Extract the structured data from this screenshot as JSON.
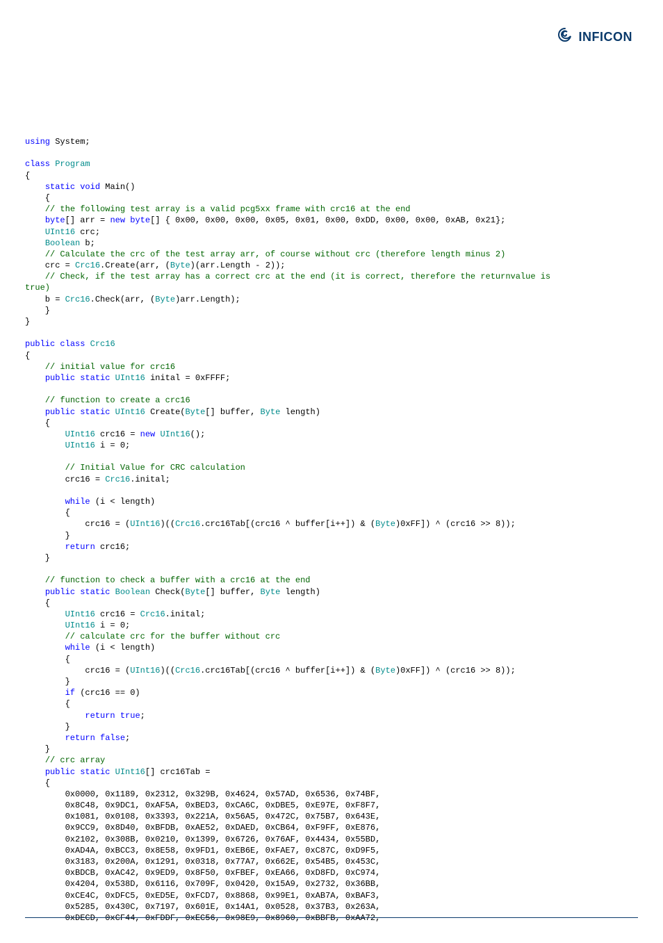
{
  "logo_text": "INFICON",
  "code_lines": [
    {
      "segments": [
        {
          "c": "kw",
          "t": "using"
        },
        {
          "c": "",
          "t": " System;"
        }
      ]
    },
    {
      "segments": [
        {
          "c": "",
          "t": ""
        }
      ]
    },
    {
      "segments": [
        {
          "c": "kw",
          "t": "class"
        },
        {
          "c": "",
          "t": " "
        },
        {
          "c": "typ",
          "t": "Program"
        }
      ]
    },
    {
      "segments": [
        {
          "c": "",
          "t": "{"
        }
      ]
    },
    {
      "segments": [
        {
          "c": "",
          "t": "    "
        },
        {
          "c": "kw",
          "t": "static"
        },
        {
          "c": "",
          "t": " "
        },
        {
          "c": "kw",
          "t": "void"
        },
        {
          "c": "",
          "t": " Main()"
        }
      ]
    },
    {
      "segments": [
        {
          "c": "",
          "t": "    {"
        }
      ]
    },
    {
      "segments": [
        {
          "c": "",
          "t": "    "
        },
        {
          "c": "cmt",
          "t": "// the following test array is a valid pcg5xx frame with crc16 at the end"
        }
      ]
    },
    {
      "segments": [
        {
          "c": "",
          "t": "    "
        },
        {
          "c": "kw",
          "t": "byte"
        },
        {
          "c": "",
          "t": "[] arr = "
        },
        {
          "c": "kw",
          "t": "new"
        },
        {
          "c": "",
          "t": " "
        },
        {
          "c": "kw",
          "t": "byte"
        },
        {
          "c": "",
          "t": "[] { 0x00, 0x00, 0x00, 0x05, 0x01, 0x00, 0xDD, 0x00, 0x00, 0xAB, 0x21};"
        }
      ]
    },
    {
      "segments": [
        {
          "c": "",
          "t": "    "
        },
        {
          "c": "typ",
          "t": "UInt16"
        },
        {
          "c": "",
          "t": " crc;"
        }
      ]
    },
    {
      "segments": [
        {
          "c": "",
          "t": "    "
        },
        {
          "c": "typ",
          "t": "Boolean"
        },
        {
          "c": "",
          "t": " b;"
        }
      ]
    },
    {
      "segments": [
        {
          "c": "",
          "t": "    "
        },
        {
          "c": "cmt",
          "t": "// Calculate the crc of the test array arr, of course without crc (therefore length minus 2)"
        }
      ]
    },
    {
      "segments": [
        {
          "c": "",
          "t": "    crc = "
        },
        {
          "c": "typ",
          "t": "Crc16"
        },
        {
          "c": "",
          "t": ".Create(arr, ("
        },
        {
          "c": "typ",
          "t": "Byte"
        },
        {
          "c": "",
          "t": ")(arr.Length - 2));"
        }
      ]
    },
    {
      "segments": [
        {
          "c": "",
          "t": "    "
        },
        {
          "c": "cmt",
          "t": "// Check, if the test array has a correct crc at the end (it is correct, therefore the returnvalue is "
        }
      ]
    },
    {
      "segments": [
        {
          "c": "cmt",
          "t": "true)"
        }
      ]
    },
    {
      "segments": [
        {
          "c": "",
          "t": "    b = "
        },
        {
          "c": "typ",
          "t": "Crc16"
        },
        {
          "c": "",
          "t": ".Check(arr, ("
        },
        {
          "c": "typ",
          "t": "Byte"
        },
        {
          "c": "",
          "t": ")arr.Length);"
        }
      ]
    },
    {
      "segments": [
        {
          "c": "",
          "t": "    }"
        }
      ]
    },
    {
      "segments": [
        {
          "c": "",
          "t": "}"
        }
      ]
    },
    {
      "segments": [
        {
          "c": "",
          "t": ""
        }
      ]
    },
    {
      "segments": [
        {
          "c": "kw",
          "t": "public"
        },
        {
          "c": "",
          "t": " "
        },
        {
          "c": "kw",
          "t": "class"
        },
        {
          "c": "",
          "t": " "
        },
        {
          "c": "typ",
          "t": "Crc16"
        }
      ]
    },
    {
      "segments": [
        {
          "c": "",
          "t": "{"
        }
      ]
    },
    {
      "segments": [
        {
          "c": "",
          "t": "    "
        },
        {
          "c": "cmt",
          "t": "// initial value for crc16"
        }
      ]
    },
    {
      "segments": [
        {
          "c": "",
          "t": "    "
        },
        {
          "c": "kw",
          "t": "public"
        },
        {
          "c": "",
          "t": " "
        },
        {
          "c": "kw",
          "t": "static"
        },
        {
          "c": "",
          "t": " "
        },
        {
          "c": "typ",
          "t": "UInt16"
        },
        {
          "c": "",
          "t": " inital = 0xFFFF;"
        }
      ]
    },
    {
      "segments": [
        {
          "c": "",
          "t": ""
        }
      ]
    },
    {
      "segments": [
        {
          "c": "",
          "t": "    "
        },
        {
          "c": "cmt",
          "t": "// function to create a crc16"
        }
      ]
    },
    {
      "segments": [
        {
          "c": "",
          "t": "    "
        },
        {
          "c": "kw",
          "t": "public"
        },
        {
          "c": "",
          "t": " "
        },
        {
          "c": "kw",
          "t": "static"
        },
        {
          "c": "",
          "t": " "
        },
        {
          "c": "typ",
          "t": "UInt16"
        },
        {
          "c": "",
          "t": " Create("
        },
        {
          "c": "typ",
          "t": "Byte"
        },
        {
          "c": "",
          "t": "[] buffer, "
        },
        {
          "c": "typ",
          "t": "Byte"
        },
        {
          "c": "",
          "t": " length)"
        }
      ]
    },
    {
      "segments": [
        {
          "c": "",
          "t": "    {"
        }
      ]
    },
    {
      "segments": [
        {
          "c": "",
          "t": "        "
        },
        {
          "c": "typ",
          "t": "UInt16"
        },
        {
          "c": "",
          "t": " crc16 = "
        },
        {
          "c": "kw",
          "t": "new"
        },
        {
          "c": "",
          "t": " "
        },
        {
          "c": "typ",
          "t": "UInt16"
        },
        {
          "c": "",
          "t": "();"
        }
      ]
    },
    {
      "segments": [
        {
          "c": "",
          "t": "        "
        },
        {
          "c": "typ",
          "t": "UInt16"
        },
        {
          "c": "",
          "t": " i = 0;"
        }
      ]
    },
    {
      "segments": [
        {
          "c": "",
          "t": ""
        }
      ]
    },
    {
      "segments": [
        {
          "c": "",
          "t": "        "
        },
        {
          "c": "cmt",
          "t": "// Initial Value for CRC calculation"
        }
      ]
    },
    {
      "segments": [
        {
          "c": "",
          "t": "        crc16 = "
        },
        {
          "c": "typ",
          "t": "Crc16"
        },
        {
          "c": "",
          "t": ".inital;"
        }
      ]
    },
    {
      "segments": [
        {
          "c": "",
          "t": ""
        }
      ]
    },
    {
      "segments": [
        {
          "c": "",
          "t": "        "
        },
        {
          "c": "kw",
          "t": "while"
        },
        {
          "c": "",
          "t": " (i < length)"
        }
      ]
    },
    {
      "segments": [
        {
          "c": "",
          "t": "        {"
        }
      ]
    },
    {
      "segments": [
        {
          "c": "",
          "t": "            crc16 = ("
        },
        {
          "c": "typ",
          "t": "UInt16"
        },
        {
          "c": "",
          "t": ")(("
        },
        {
          "c": "typ",
          "t": "Crc16"
        },
        {
          "c": "",
          "t": ".crc16Tab[(crc16 ^ buffer[i++]) & ("
        },
        {
          "c": "typ",
          "t": "Byte"
        },
        {
          "c": "",
          "t": ")0xFF]) ^ (crc16 >> 8));"
        }
      ]
    },
    {
      "segments": [
        {
          "c": "",
          "t": "        }"
        }
      ]
    },
    {
      "segments": [
        {
          "c": "",
          "t": "        "
        },
        {
          "c": "kw",
          "t": "return"
        },
        {
          "c": "",
          "t": " crc16;"
        }
      ]
    },
    {
      "segments": [
        {
          "c": "",
          "t": "    }"
        }
      ]
    },
    {
      "segments": [
        {
          "c": "",
          "t": ""
        }
      ]
    },
    {
      "segments": [
        {
          "c": "",
          "t": "    "
        },
        {
          "c": "cmt",
          "t": "// function to check a buffer with a crc16 at the end"
        }
      ]
    },
    {
      "segments": [
        {
          "c": "",
          "t": "    "
        },
        {
          "c": "kw",
          "t": "public"
        },
        {
          "c": "",
          "t": " "
        },
        {
          "c": "kw",
          "t": "static"
        },
        {
          "c": "",
          "t": " "
        },
        {
          "c": "typ",
          "t": "Boolean"
        },
        {
          "c": "",
          "t": " Check("
        },
        {
          "c": "typ",
          "t": "Byte"
        },
        {
          "c": "",
          "t": "[] buffer, "
        },
        {
          "c": "typ",
          "t": "Byte"
        },
        {
          "c": "",
          "t": " length)"
        }
      ]
    },
    {
      "segments": [
        {
          "c": "",
          "t": "    {"
        }
      ]
    },
    {
      "segments": [
        {
          "c": "",
          "t": "        "
        },
        {
          "c": "typ",
          "t": "UInt16"
        },
        {
          "c": "",
          "t": " crc16 = "
        },
        {
          "c": "typ",
          "t": "Crc16"
        },
        {
          "c": "",
          "t": ".inital;"
        }
      ]
    },
    {
      "segments": [
        {
          "c": "",
          "t": "        "
        },
        {
          "c": "typ",
          "t": "UInt16"
        },
        {
          "c": "",
          "t": " i = 0;"
        }
      ]
    },
    {
      "segments": [
        {
          "c": "",
          "t": "        "
        },
        {
          "c": "cmt",
          "t": "// calculate crc for the buffer without crc"
        }
      ]
    },
    {
      "segments": [
        {
          "c": "",
          "t": "        "
        },
        {
          "c": "kw",
          "t": "while"
        },
        {
          "c": "",
          "t": " (i < length)"
        }
      ]
    },
    {
      "segments": [
        {
          "c": "",
          "t": "        {"
        }
      ]
    },
    {
      "segments": [
        {
          "c": "",
          "t": "            crc16 = ("
        },
        {
          "c": "typ",
          "t": "UInt16"
        },
        {
          "c": "",
          "t": ")(("
        },
        {
          "c": "typ",
          "t": "Crc16"
        },
        {
          "c": "",
          "t": ".crc16Tab[(crc16 ^ buffer[i++]) & ("
        },
        {
          "c": "typ",
          "t": "Byte"
        },
        {
          "c": "",
          "t": ")0xFF]) ^ (crc16 >> 8));"
        }
      ]
    },
    {
      "segments": [
        {
          "c": "",
          "t": "        }"
        }
      ]
    },
    {
      "segments": [
        {
          "c": "",
          "t": "        "
        },
        {
          "c": "kw",
          "t": "if"
        },
        {
          "c": "",
          "t": " (crc16 == 0)"
        }
      ]
    },
    {
      "segments": [
        {
          "c": "",
          "t": "        {"
        }
      ]
    },
    {
      "segments": [
        {
          "c": "",
          "t": "            "
        },
        {
          "c": "kw",
          "t": "return"
        },
        {
          "c": "",
          "t": " "
        },
        {
          "c": "kw",
          "t": "true"
        },
        {
          "c": "",
          "t": ";"
        }
      ]
    },
    {
      "segments": [
        {
          "c": "",
          "t": "        }"
        }
      ]
    },
    {
      "segments": [
        {
          "c": "",
          "t": "        "
        },
        {
          "c": "kw",
          "t": "return"
        },
        {
          "c": "",
          "t": " "
        },
        {
          "c": "kw",
          "t": "false"
        },
        {
          "c": "",
          "t": ";"
        }
      ]
    },
    {
      "segments": [
        {
          "c": "",
          "t": "    }"
        }
      ]
    },
    {
      "segments": [
        {
          "c": "",
          "t": "    "
        },
        {
          "c": "cmt",
          "t": "// crc array"
        }
      ]
    },
    {
      "segments": [
        {
          "c": "",
          "t": "    "
        },
        {
          "c": "kw",
          "t": "public"
        },
        {
          "c": "",
          "t": " "
        },
        {
          "c": "kw",
          "t": "static"
        },
        {
          "c": "",
          "t": " "
        },
        {
          "c": "typ",
          "t": "UInt16"
        },
        {
          "c": "",
          "t": "[] crc16Tab ="
        }
      ]
    },
    {
      "segments": [
        {
          "c": "",
          "t": "    {"
        }
      ]
    },
    {
      "segments": [
        {
          "c": "",
          "t": "        0x0000, 0x1189, 0x2312, 0x329B, 0x4624, 0x57AD, 0x6536, 0x74BF,"
        }
      ]
    },
    {
      "segments": [
        {
          "c": "",
          "t": "        0x8C48, 0x9DC1, 0xAF5A, 0xBED3, 0xCA6C, 0xDBE5, 0xE97E, 0xF8F7,"
        }
      ]
    },
    {
      "segments": [
        {
          "c": "",
          "t": "        0x1081, 0x0108, 0x3393, 0x221A, 0x56A5, 0x472C, 0x75B7, 0x643E,"
        }
      ]
    },
    {
      "segments": [
        {
          "c": "",
          "t": "        0x9CC9, 0x8D40, 0xBFDB, 0xAE52, 0xDAED, 0xCB64, 0xF9FF, 0xE876,"
        }
      ]
    },
    {
      "segments": [
        {
          "c": "",
          "t": "        0x2102, 0x308B, 0x0210, 0x1399, 0x6726, 0x76AF, 0x4434, 0x55BD,"
        }
      ]
    },
    {
      "segments": [
        {
          "c": "",
          "t": "        0xAD4A, 0xBCC3, 0x8E58, 0x9FD1, 0xEB6E, 0xFAE7, 0xC87C, 0xD9F5,"
        }
      ]
    },
    {
      "segments": [
        {
          "c": "",
          "t": "        0x3183, 0x200A, 0x1291, 0x0318, 0x77A7, 0x662E, 0x54B5, 0x453C,"
        }
      ]
    },
    {
      "segments": [
        {
          "c": "",
          "t": "        0xBDCB, 0xAC42, 0x9ED9, 0x8F50, 0xFBEF, 0xEA66, 0xD8FD, 0xC974,"
        }
      ]
    },
    {
      "segments": [
        {
          "c": "",
          "t": "        0x4204, 0x538D, 0x6116, 0x709F, 0x0420, 0x15A9, 0x2732, 0x36BB,"
        }
      ]
    },
    {
      "segments": [
        {
          "c": "",
          "t": "        0xCE4C, 0xDFC5, 0xED5E, 0xFCD7, 0x8868, 0x99E1, 0xAB7A, 0xBAF3,"
        }
      ]
    },
    {
      "segments": [
        {
          "c": "",
          "t": "        0x5285, 0x430C, 0x7197, 0x601E, 0x14A1, 0x0528, 0x37B3, 0x263A,"
        }
      ]
    },
    {
      "segments": [
        {
          "c": "",
          "t": "        0xDECD, 0xCF44, 0xFDDF, 0xEC56, 0x98E9, 0x8960, 0xBBFB, 0xAA72,"
        }
      ]
    }
  ]
}
